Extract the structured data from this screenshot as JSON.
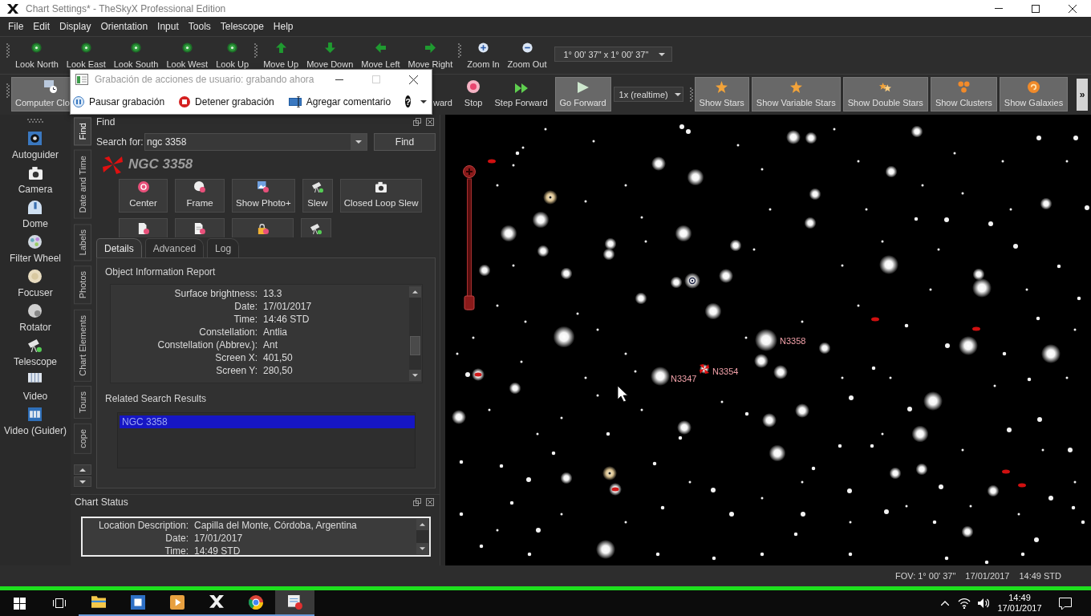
{
  "window": {
    "title": "Chart Settings* - TheSkyX Professional Edition"
  },
  "menu": [
    "File",
    "Edit",
    "Display",
    "Orientation",
    "Input",
    "Tools",
    "Telescope",
    "Help"
  ],
  "navigation_toolbar": {
    "look": [
      "Look North",
      "Look East",
      "Look South",
      "Look West",
      "Look Up"
    ],
    "move": [
      "Move Up",
      "Move Down",
      "Move Left",
      "Move Right"
    ],
    "zoom": [
      "Zoom In",
      "Zoom Out"
    ],
    "fov": "1° 00' 37\" x 1° 00' 37\""
  },
  "time_toolbar": {
    "left_buttons": [
      {
        "label": "Computer Clo",
        "on": true
      }
    ],
    "buttons": [
      {
        "label": "ward",
        "on": false
      },
      {
        "label": "Stop",
        "on": false
      },
      {
        "label": "Step Forward",
        "on": false
      },
      {
        "label": "Go Forward",
        "on": true
      }
    ],
    "rate": "1x (realtime)",
    "display_buttons": [
      {
        "label": "Show Stars",
        "on": true
      },
      {
        "label": "Show Variable Stars",
        "on": true
      },
      {
        "label": "Show Double Stars",
        "on": true
      },
      {
        "label": "Show Clusters",
        "on": true
      },
      {
        "label": "Show Galaxies",
        "on": true
      }
    ],
    "overflow": "»"
  },
  "recorder_dialog": {
    "title": "Grabación de acciones de usuario: grabando ahora",
    "buttons": [
      "Pausar grabación",
      "Detener grabación",
      "Agregar comentario"
    ],
    "help": "?"
  },
  "devices": [
    "Autoguider",
    "Camera",
    "Dome",
    "Filter Wheel",
    "Focuser",
    "Rotator",
    "Telescope",
    "Video",
    "Video (Guider)"
  ],
  "side_tabs": [
    {
      "label": "Find",
      "selected": true
    },
    {
      "label": "Date and Time",
      "selected": false
    },
    {
      "label": "Labels",
      "selected": false
    },
    {
      "label": "Photos",
      "selected": false
    },
    {
      "label": "Chart Elements",
      "selected": false
    },
    {
      "label": "Tours",
      "selected": false
    },
    {
      "label": "cope",
      "selected": false
    }
  ],
  "find_panel": {
    "title": "Find",
    "search_label": "Search for:",
    "search_value": "ngc 3358",
    "find_button": "Find",
    "object_name": "NGC 3358",
    "actions": [
      "Center",
      "Frame",
      "Show Photo+",
      "Slew",
      "Closed Loop Slew"
    ],
    "tabs": [
      {
        "label": "Details",
        "selected": true
      },
      {
        "label": "Advanced",
        "selected": false
      },
      {
        "label": "Log",
        "selected": false
      }
    ],
    "report_title": "Object Information Report",
    "report": [
      {
        "key": "Surface brightness:",
        "value": "13.3"
      },
      {
        "key": "Date:",
        "value": "17/01/2017"
      },
      {
        "key": "Time:",
        "value": "14:46 STD"
      },
      {
        "key": "Constellation:",
        "value": "Antlia"
      },
      {
        "key": "Constellation (Abbrev.):",
        "value": "Ant"
      },
      {
        "key": "Screen X:",
        "value": "401,50"
      },
      {
        "key": "Screen Y:",
        "value": "280,50"
      }
    ],
    "related_title": "Related Search Results",
    "related": [
      {
        "label": "NGC 3358",
        "selected": true
      }
    ]
  },
  "chart_status": {
    "title": "Chart Status",
    "rows": [
      {
        "key": "Location Description:",
        "value": "Capilla del Monte, Córdoba, Argentina"
      },
      {
        "key": "Date:",
        "value": "17/01/2017"
      },
      {
        "key": "Time:",
        "value": "14:49 STD"
      }
    ]
  },
  "sky_chart": {
    "labels": [
      "N3358",
      "N3354",
      "N3347"
    ],
    "zoom": {
      "level": 0
    }
  },
  "status_bar": [
    "FOV: 1° 00' 37\"",
    "17/01/2017",
    "14:49 STD"
  ],
  "taskbar": {
    "apps": [
      {
        "selected": false
      },
      {
        "selected": false
      },
      {
        "selected": false
      },
      {
        "selected": false
      },
      {
        "selected": false
      },
      {
        "selected": true
      }
    ],
    "clock": {
      "time": "14:49",
      "date": "17/01/2017"
    }
  }
}
